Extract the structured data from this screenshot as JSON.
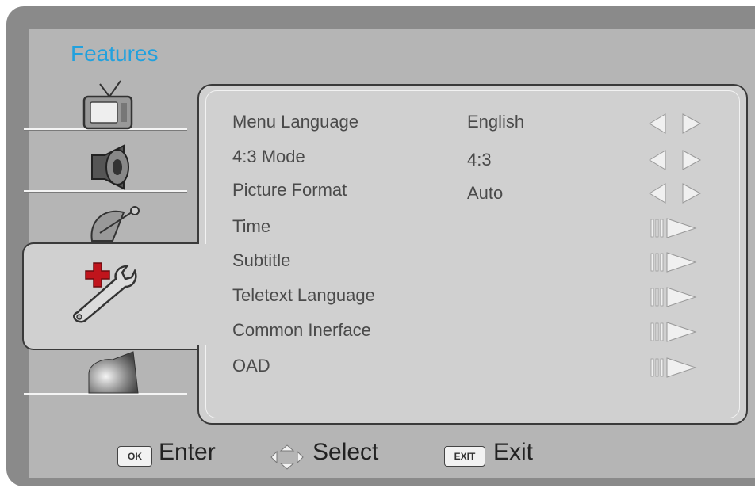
{
  "menu": {
    "title": "Features",
    "tabs": [
      {
        "icon": "tv-icon",
        "active": false
      },
      {
        "icon": "speaker-icon",
        "active": false
      },
      {
        "icon": "satellite-dish-icon",
        "active": false
      },
      {
        "icon": "tools-icon",
        "active": true
      },
      {
        "icon": "media-icon",
        "active": false
      }
    ],
    "items": [
      {
        "label": "Menu Language",
        "value": "English",
        "control": "left-right"
      },
      {
        "label": "4:3 Mode",
        "value": "4:3",
        "control": "left-right"
      },
      {
        "label": "Picture Format",
        "value": "Auto",
        "control": "left-right"
      },
      {
        "label": "Time",
        "value": "",
        "control": "enter"
      },
      {
        "label": "Subtitle",
        "value": "",
        "control": "enter"
      },
      {
        "label": "Teletext Language",
        "value": "",
        "control": "enter"
      },
      {
        "label": "Common Inerface",
        "value": "",
        "control": "enter"
      },
      {
        "label": "OAD",
        "value": "",
        "control": "enter"
      }
    ]
  },
  "footer": {
    "ok_key": "OK",
    "ok_label": "Enter",
    "nav_icon": "navigate-arrows-icon",
    "nav_label": "Select",
    "exit_key": "EXIT",
    "exit_label": "Exit"
  },
  "colors": {
    "frame": "#8a8a8a",
    "background": "#b5b5b5",
    "panel": "#d0d0d0",
    "title": "#21a1de",
    "accent_red": "#c0141c"
  }
}
